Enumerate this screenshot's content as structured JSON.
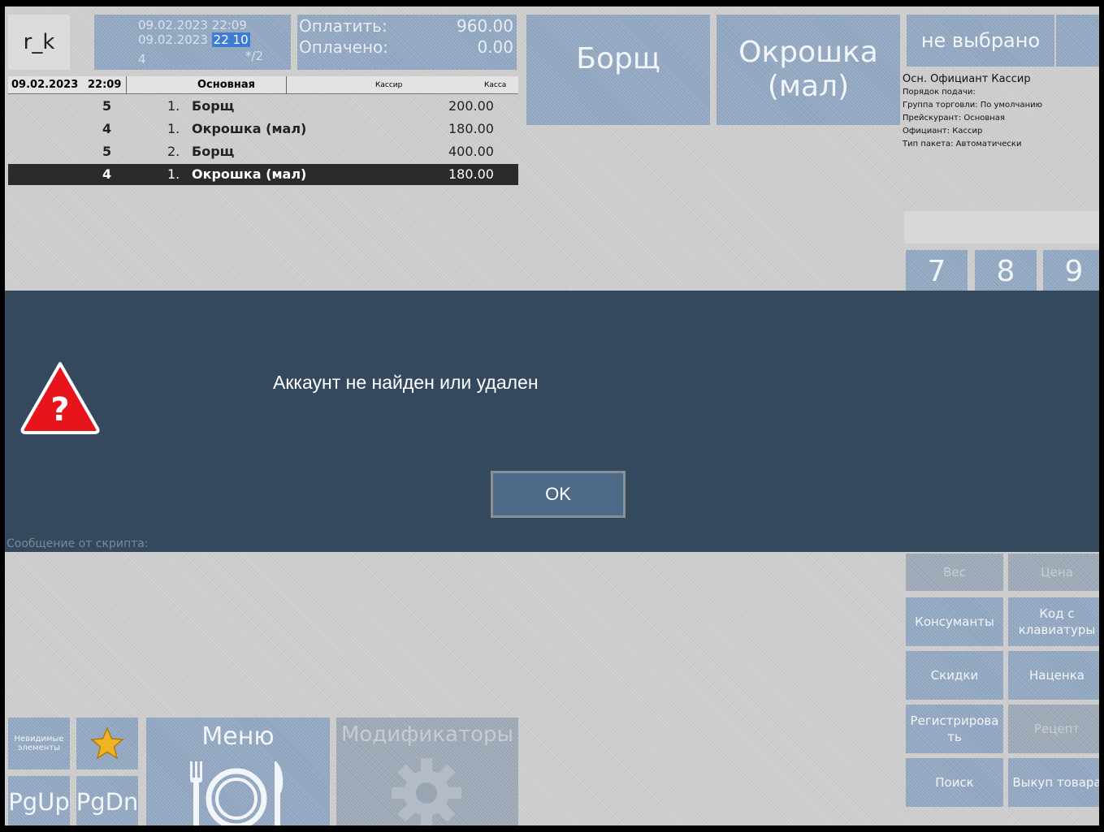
{
  "order": {
    "logo": "r_k",
    "date_open": "09.02.2023 22:09",
    "date_close_day": "09.02.2023",
    "date_close_time": "22 10",
    "guests": "4",
    "fraction": "*/2",
    "pay_label": "Оплатить:",
    "pay_value": "960.00",
    "paid_label": "Оплачено:",
    "paid_value": "0.00"
  },
  "table_header": {
    "date": "09.02.2023",
    "time": "22:09",
    "course": "Основная",
    "waiter": "Кассир",
    "register": "Касса"
  },
  "rows": [
    {
      "seat": "5",
      "num": "1.",
      "name": "Борщ",
      "price": "200.00"
    },
    {
      "seat": "4",
      "num": "1.",
      "name": "Окрошка (мал)",
      "price": "180.00"
    },
    {
      "seat": "5",
      "num": "2.",
      "name": "Борщ",
      "price": "400.00"
    },
    {
      "seat": "4",
      "num": "1.",
      "name": "Окрошка (мал)",
      "price": "180.00"
    }
  ],
  "dishes": {
    "dish1": "Борщ",
    "dish2_line1": "Окрошка",
    "dish2_line2": "(мал)"
  },
  "waiter": {
    "button": "не выбрано",
    "info_main": "Осн. Официант  Кассир",
    "info_order": "Порядок подачи:",
    "info_group": "Группа торговли: По умолчанию",
    "info_price": "Прейскурант: Основная",
    "info_waiter": "Официант: Кассир",
    "info_package": "Тип пакета: Автоматически"
  },
  "keypad": [
    "7",
    "8",
    "9"
  ],
  "dialog": {
    "message": "Аккаунт не найден или удален",
    "ok": "OK",
    "script_label": "Сообщение от скрипта:"
  },
  "functions": {
    "weight": "Вес",
    "price": "Цена",
    "consumers": "Консуманты",
    "keyboard_code": "Код с клавиатуры",
    "discounts": "Скидки",
    "markup": "Наценка",
    "register": "Регистрировать",
    "recipe": "Рецепт",
    "search": "Поиск",
    "buyback": "Выкуп товара"
  },
  "bottom": {
    "invisible": "Невидимые элементы",
    "pgup": "PgUp",
    "pgdn": "PgDn",
    "menu": "Меню",
    "modifiers": "Модификаторы"
  },
  "colors": {
    "tile": "#8ea3bd",
    "dialog": "#34495e",
    "selected_row": "#2b2b2b",
    "warning": "#e8141b"
  }
}
